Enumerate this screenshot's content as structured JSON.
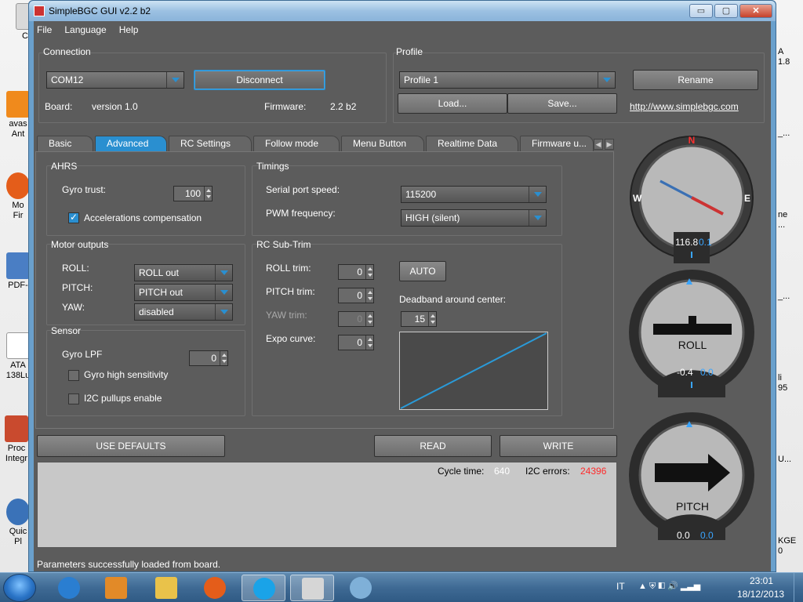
{
  "desktop": {
    "left_icons": [
      {
        "label": "Ce"
      },
      {
        "label": "avas\nAnt"
      },
      {
        "label": "Mo\nFir"
      },
      {
        "label": "PDF-"
      },
      {
        "label": "ATA\n138Lu"
      },
      {
        "label": "Proc\nIntegr"
      },
      {
        "label": "Quic\nPl"
      }
    ],
    "right_labels": [
      "A\n1.8",
      "_...",
      "ne\n...",
      "_...",
      "li\n95",
      "U...",
      "KGE\n0"
    ]
  },
  "window": {
    "title": "SimpleBGC GUI v2.2 b2",
    "controls": {
      "minimize": "▭",
      "maximize": "▢",
      "close": "✕"
    }
  },
  "menu": [
    "File",
    "Language",
    "Help"
  ],
  "connection": {
    "title": "Connection",
    "port": "COM12",
    "disconnect": "Disconnect",
    "board_label": "Board:",
    "board_value": "version 1.0",
    "firmware_label": "Firmware:",
    "firmware_value": "2.2 b2"
  },
  "profile": {
    "title": "Profile",
    "selected": "Profile 1",
    "rename": "Rename",
    "load": "Load...",
    "save": "Save...",
    "link": "http://www.simplebgc.com"
  },
  "tabs": [
    "Basic",
    "Advanced",
    "RC Settings",
    "Follow mode",
    "Menu Button",
    "Realtime Data",
    "Firmware u..."
  ],
  "ahrs": {
    "title": "AHRS",
    "gyro_trust_label": "Gyro trust:",
    "gyro_trust_value": "100",
    "acc_comp_label": "Accelerations compensation"
  },
  "timings": {
    "title": "Timings",
    "serial_label": "Serial port speed:",
    "serial_value": "115200",
    "pwm_label": "PWM frequency:",
    "pwm_value": "HIGH (silent)"
  },
  "motor_outputs": {
    "title": "Motor outputs",
    "roll_label": "ROLL:",
    "roll_value": "ROLL out",
    "pitch_label": "PITCH:",
    "pitch_value": "PITCH out",
    "yaw_label": "YAW:",
    "yaw_value": "disabled"
  },
  "rc_subtrim": {
    "title": "RC Sub-Trim",
    "roll_label": "ROLL trim:",
    "roll_value": "0",
    "pitch_label": "PITCH trim:",
    "pitch_value": "0",
    "yaw_label": "YAW trim:",
    "yaw_value": "0",
    "expo_label": "Expo curve:",
    "expo_value": "0",
    "auto": "AUTO",
    "deadband_label": "Deadband around center:",
    "deadband_value": "15"
  },
  "sensor": {
    "title": "Sensor",
    "gyro_lpf_label": "Gyro LPF",
    "gyro_lpf_value": "0",
    "gyro_high_label": "Gyro high sensitivity",
    "i2c_label": "I2C pullups enable"
  },
  "actions": {
    "defaults": "USE DEFAULTS",
    "read": "READ",
    "write": "WRITE"
  },
  "log": {
    "cycle_label": "Cycle time:",
    "cycle_value": "640",
    "i2c_label": "I2C errors:",
    "i2c_value": "24396"
  },
  "status": "Parameters successfully loaded from board.",
  "gauges": {
    "compass": {
      "n": "N",
      "w": "W",
      "e": "E",
      "value": "116.8",
      "value2": "0.1"
    },
    "roll": {
      "label": "ROLL",
      "value1": "-0.4",
      "value2": "0.0"
    },
    "pitch": {
      "label": "PITCH",
      "value1": "0.0",
      "value2": "0.0"
    }
  },
  "taskbar": {
    "lang": "IT",
    "time": "23:01",
    "date": "18/12/2013"
  },
  "colors": {
    "accent": "#2a8fd0",
    "error": "#ff2a2a",
    "panel": "#5c5c5c"
  }
}
